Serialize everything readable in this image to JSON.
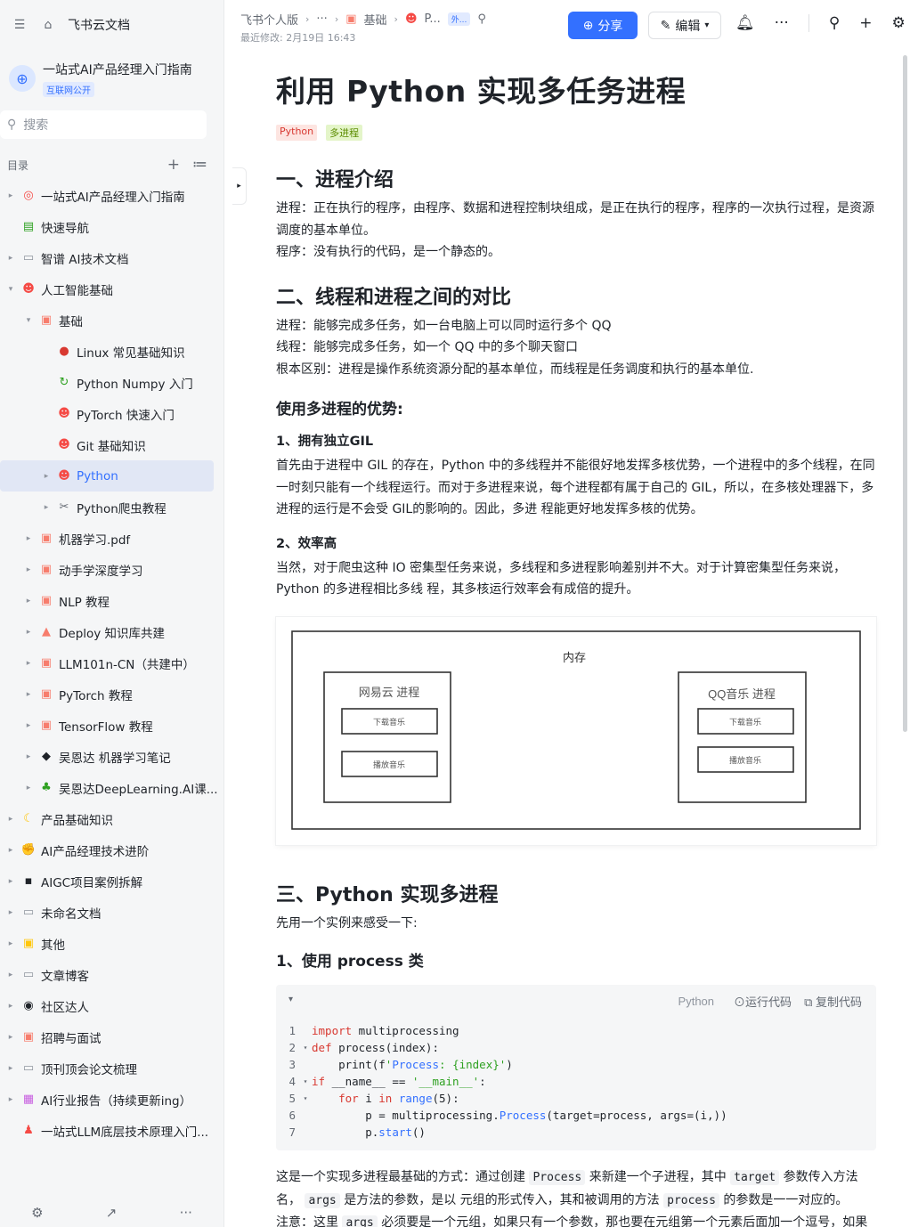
{
  "sidebar": {
    "app_name": "飞书云文档",
    "wiki_title": "一站式AI产品经理入门指南",
    "wiki_badge": "互联网公开",
    "search_placeholder": "搜索",
    "dir_label": "目录",
    "items": [
      {
        "label": "一站式AI产品经理入门指南",
        "level": 0,
        "arrow": "▸",
        "icon": "target-icon",
        "color": "#f54a45"
      },
      {
        "label": "快速导航",
        "level": 0,
        "arrow": "",
        "icon": "sheet-icon",
        "color": "#2ea121"
      },
      {
        "label": "智谱 AI技术文档",
        "level": 0,
        "arrow": "▸",
        "icon": "doc-icon",
        "color": "#8f959e"
      },
      {
        "label": "人工智能基础",
        "level": 0,
        "arrow": "▾",
        "icon": "face-icon",
        "color": "#f54a45"
      },
      {
        "label": "基础",
        "level": 1,
        "arrow": "▾",
        "icon": "folder-icon",
        "color": "#f77d6d"
      },
      {
        "label": "Linux 常见基础知识",
        "level": 2,
        "arrow": "",
        "icon": "apple-icon",
        "color": "#d83931"
      },
      {
        "label": "Python Numpy 入门",
        "level": 2,
        "arrow": "",
        "icon": "refresh-icon",
        "color": "#2ea121"
      },
      {
        "label": "PyTorch 快速入门",
        "level": 2,
        "arrow": "",
        "icon": "face-icon",
        "color": "#f54a45"
      },
      {
        "label": "Git 基础知识",
        "level": 2,
        "arrow": "",
        "icon": "face-icon",
        "color": "#f54a45"
      },
      {
        "label": "Python",
        "level": 2,
        "arrow": "▸",
        "icon": "face-icon",
        "color": "#f54a45",
        "active": true
      },
      {
        "label": "Python爬虫教程",
        "level": 2,
        "arrow": "▸",
        "icon": "tools-icon",
        "color": "#646a73"
      },
      {
        "label": "机器学习.pdf",
        "level": 1,
        "arrow": "▸",
        "icon": "pdf-icon",
        "color": "#f77d6d"
      },
      {
        "label": "动手学深度学习",
        "level": 1,
        "arrow": "▸",
        "icon": "book-icon",
        "color": "#f77d6d"
      },
      {
        "label": "NLP 教程",
        "level": 1,
        "arrow": "▸",
        "icon": "book-icon",
        "color": "#f77d6d"
      },
      {
        "label": "Deploy 知识库共建",
        "level": 1,
        "arrow": "▸",
        "icon": "chart-icon",
        "color": "#f77d6d"
      },
      {
        "label": "LLM101n-CN（共建中）",
        "level": 1,
        "arrow": "▸",
        "icon": "book-icon",
        "color": "#f77d6d"
      },
      {
        "label": "PyTorch 教程",
        "level": 1,
        "arrow": "▸",
        "icon": "book-icon",
        "color": "#f77d6d"
      },
      {
        "label": "TensorFlow 教程",
        "level": 1,
        "arrow": "▸",
        "icon": "book-icon",
        "color": "#f77d6d"
      },
      {
        "label": "吴恩达 机器学习笔记",
        "level": 1,
        "arrow": "▸",
        "icon": "grad-cap-icon",
        "color": "#1f2329"
      },
      {
        "label": "吴恩达DeepLearning.AI课...",
        "level": 1,
        "arrow": "▸",
        "icon": "tree-icon",
        "color": "#2ea121"
      },
      {
        "label": "产品基础知识",
        "level": 0,
        "arrow": "▸",
        "icon": "crescent-icon",
        "color": "#ffc60a"
      },
      {
        "label": "AI产品经理技术进阶",
        "level": 0,
        "arrow": "▸",
        "icon": "muscle-icon",
        "color": "#ffc60a"
      },
      {
        "label": "AIGC项目案例拆解",
        "level": 0,
        "arrow": "▸",
        "icon": "disk-icon",
        "color": "#1f2329"
      },
      {
        "label": "未命名文档",
        "level": 0,
        "arrow": "▸",
        "icon": "doc-icon",
        "color": "#8f959e"
      },
      {
        "label": "其他",
        "level": 0,
        "arrow": "▸",
        "icon": "folder-icon",
        "color": "#ffc60a"
      },
      {
        "label": "文章博客",
        "level": 0,
        "arrow": "▸",
        "icon": "doc-icon",
        "color": "#8f959e"
      },
      {
        "label": "社区达人",
        "level": 0,
        "arrow": "▸",
        "icon": "eyes-icon",
        "color": "#1f2329"
      },
      {
        "label": "招聘与面试",
        "level": 0,
        "arrow": "▸",
        "icon": "folder-icon",
        "color": "#f77d6d"
      },
      {
        "label": "顶刊顶会论文梳理",
        "level": 0,
        "arrow": "▸",
        "icon": "doc-icon",
        "color": "#8f959e"
      },
      {
        "label": "AI行业报告（持续更新ing）",
        "level": 0,
        "arrow": "▸",
        "icon": "grid-icon",
        "color": "#c860e0"
      },
      {
        "label": "一站式LLM底层技术原理入门...",
        "level": 0,
        "arrow": "",
        "icon": "person-icon",
        "color": "#f54a45"
      }
    ]
  },
  "header": {
    "crumbs": [
      "飞书个人版",
      "···",
      "基础",
      "P..."
    ],
    "ext_tag": "外...",
    "updated": "最近修改: 2月19日 16:43",
    "share_label": "分享",
    "edit_label": "编辑"
  },
  "doc": {
    "title": "利用 Python 实现多任务进程",
    "tags": [
      "Python",
      "多进程"
    ],
    "s1_title": "一、进程介绍",
    "s1_p1": "进程：正在执行的程序，由程序、数据和进程控制块组成，是正在执行的程序，程序的一次执行过程，是资源调度的基本单位。",
    "s1_p2": "程序：没有执行的代码，是一个静态的。",
    "s2_title": "二、线程和进程之间的对比",
    "s2_p1": "进程：能够完成多任务，如一台电脑上可以同时运行多个 QQ",
    "s2_p2": "线程：能够完成多任务，如一个 QQ 中的多个聊天窗口",
    "s2_p3": "根本区别：进程是操作系统资源分配的基本单位，而线程是任务调度和执行的基本单位.",
    "adv_title": "使用多进程的优势:",
    "adv1_title": "1、拥有独立GIL",
    "adv1_p": "首先由于进程中 GIL 的存在，Python 中的多线程并不能很好地发挥多核优势，一个进程中的多个线程，在同一时刻只能有一个线程运行。而对于多进程来说，每个进程都有属于自己的 GIL，所以，在多核处理器下，多进程的运行是不会受 GIL的影响的。因此，多进 程能更好地发挥多核的优势。",
    "adv2_title": "2、效率高",
    "adv2_p": "当然，对于爬虫这种 IO 密集型任务来说，多线程和多进程影响差别并不大。对于计算密集型任务来说，Python 的多进程相比多线 程，其多核运行效率会有成倍的提升。",
    "diagram": {
      "memory": "内存",
      "proc_a": "网易云  进程",
      "proc_b": "QQ音乐  进程",
      "task_download": "下载音乐",
      "task_play": "播放音乐"
    },
    "s3_title": "三、Python 实现多进程",
    "s3_p": "先用一个实例来感受一下:",
    "s3_sub": "1、使用 process 类",
    "code_lang": "Python",
    "run_label": "运行代码",
    "copy_label": "复制代码",
    "code_lines": [
      [
        "1",
        "",
        "import multiprocessing"
      ],
      [
        "2",
        "▾",
        "def process(index):"
      ],
      [
        "3",
        "",
        "    print(f'Process: {index}')"
      ],
      [
        "4",
        "▾",
        "if __name__ == '__main__':"
      ],
      [
        "5",
        "▾",
        "    for i in range(5):"
      ],
      [
        "6",
        "",
        "        p = multiprocessing.Process(target=process, args=(i,))"
      ],
      [
        "7",
        "",
        "        p.start()"
      ]
    ],
    "after_p1_a": "这是一个实现多进程最基础的方式：通过创建",
    "after_code_process": "Process",
    "after_p1_b": "来新建一个子进程，其中",
    "after_code_target": "target",
    "after_p1_c": "参数传入方法名，",
    "after_code_args": "args",
    "after_p1_d": "是方法的参数，是以 元组的形式传入，其和被调用的方法",
    "after_code_process2": "process",
    "after_p1_e": "的参数是一一对应的。",
    "after_p2_a": "注意：这里",
    "after_code_args2": "args",
    "after_p2_b": "必须要是一个元组，如果只有一个参数，那也要在元组第一个元素后面加一个逗号，如果没有逗号则 和单个元素本身没有区别，无法构成元组，导致参数传递出现问题。创建完进程之后，通过调用"
  }
}
